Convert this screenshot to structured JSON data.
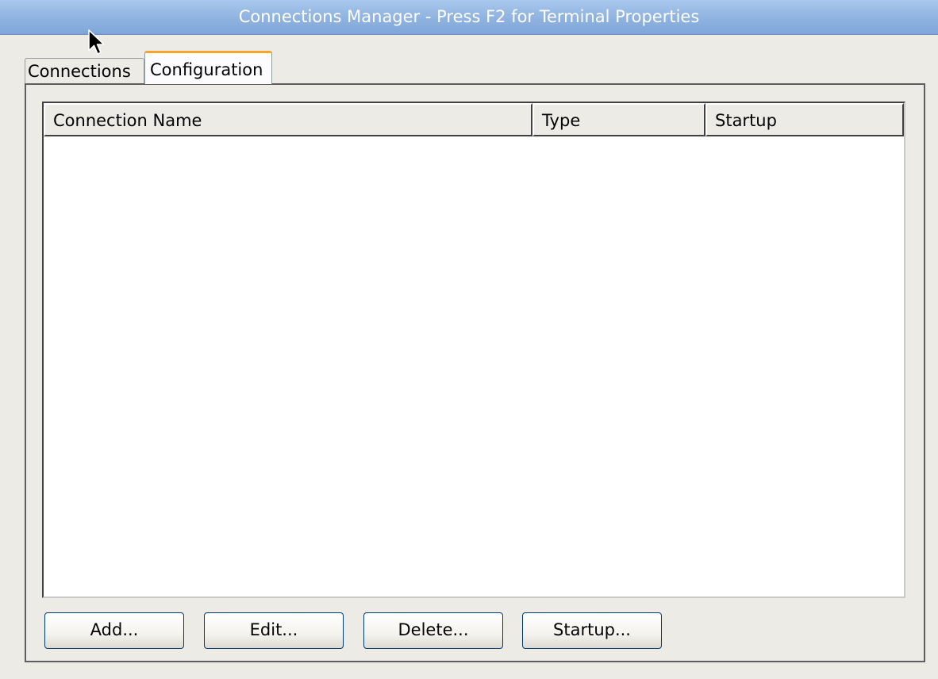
{
  "window": {
    "title": "Connections Manager - Press F2 for Terminal Properties"
  },
  "tabs": [
    {
      "label": "Connections",
      "active": false
    },
    {
      "label": "Configuration",
      "active": true
    }
  ],
  "table": {
    "columns": [
      "Connection Name",
      "Type",
      "Startup"
    ],
    "rows": []
  },
  "buttons": {
    "add": "Add...",
    "edit": "Edit...",
    "delete": "Delete...",
    "startup": "Startup..."
  },
  "colors": {
    "titlebar": "#93b6e2",
    "active_tab_accent": "#f5a52d",
    "window_bg": "#ecebe6"
  },
  "icons": {
    "cursor": "mouse-pointer-icon"
  }
}
